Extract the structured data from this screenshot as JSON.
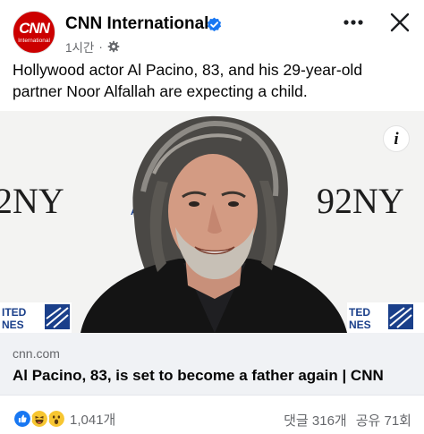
{
  "header": {
    "avatar_text": "CNN",
    "avatar_subtext": "International",
    "page_name": "CNN International",
    "time": "1시간",
    "separator": "·"
  },
  "post": {
    "text": "Hollywood actor Al Pacino, 83, and his 29-year-old partner Noor Alfallah are expecting a child."
  },
  "media": {
    "backdrop_left_logo": "2NY",
    "backdrop_right_logo": "92NY",
    "backdrop_left_small": "A",
    "backdrop_left_banner": [
      "ITED",
      "NES"
    ],
    "backdrop_right_banner": [
      "TED",
      "NES"
    ],
    "info_label": "i"
  },
  "link": {
    "domain": "cnn.com",
    "title": "Al Pacino, 83, is set to become a father again | CNN"
  },
  "footer": {
    "reaction_count": "1,041개",
    "comments": "댓글 316개",
    "shares": "공유 71회"
  },
  "colors": {
    "cnn_red": "#cc0000",
    "verified_blue": "#1877f2",
    "secondary_text": "#65676b",
    "link_bg": "#f0f2f5"
  }
}
